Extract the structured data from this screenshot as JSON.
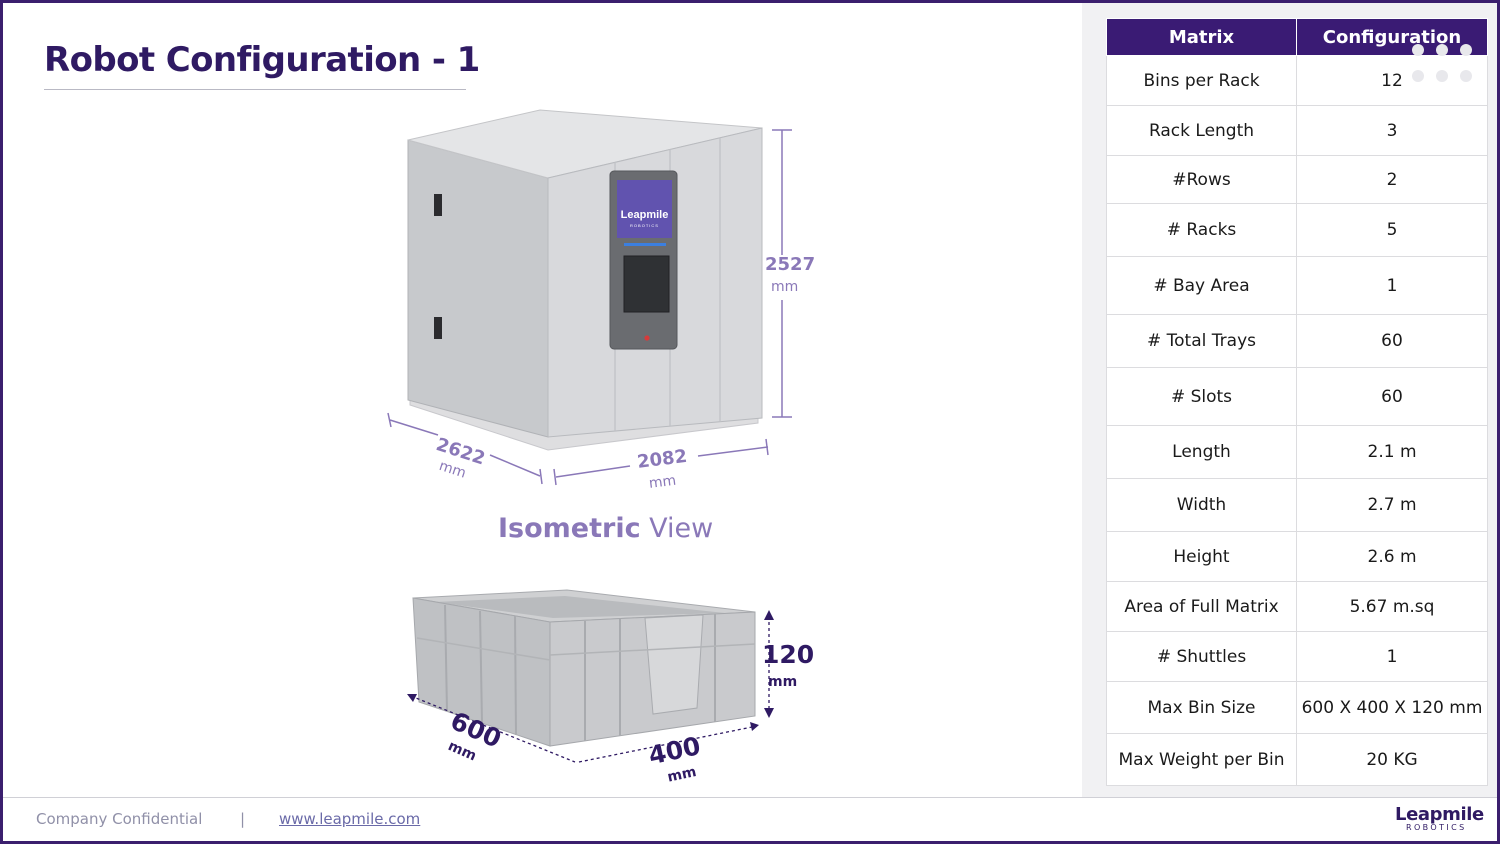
{
  "title": "Robot Configuration - 1",
  "table": {
    "header": [
      "Matrix",
      "Configuration"
    ],
    "rows": [
      [
        "Bins per Rack",
        "12"
      ],
      [
        "Rack Length",
        "3"
      ],
      [
        "#Rows",
        "2"
      ],
      [
        "# Racks",
        "5"
      ],
      [
        "# Bay Area",
        "1"
      ],
      [
        "# Total Trays",
        "60"
      ],
      [
        "# Slots",
        "60"
      ],
      [
        "Length",
        "2.1 m"
      ],
      [
        "Width",
        "2.7 m"
      ],
      [
        "Height",
        "2.6 m"
      ],
      [
        "Area of Full Matrix",
        "5.67 m.sq"
      ],
      [
        "# Shuttles",
        "1"
      ],
      [
        "Max Bin Size",
        "600 X 400 X 120 mm"
      ],
      [
        "Max Weight per Bin",
        "20 KG"
      ]
    ]
  },
  "machine": {
    "screen_logo": "Leapmile",
    "screen_logo_sub": "ROBOTICS",
    "height_value": "2527",
    "height_unit": "mm",
    "depth_value": "2622",
    "depth_unit": "mm",
    "width_value": "2082",
    "width_unit": "mm"
  },
  "caption": {
    "bold": "Isometric",
    "rest": " View"
  },
  "bin": {
    "height_value": "120",
    "height_unit": "mm",
    "length_value": "600",
    "length_unit": "mm",
    "width_value": "400",
    "width_unit": "mm"
  },
  "footer": {
    "confidential": "Company Confidential",
    "separator": "|",
    "website": "www.leapmile.com",
    "logo": "Leapmile",
    "logo_sub": "ROBOTICS"
  },
  "colors": {
    "brand_dark": "#2f1a63",
    "table_header": "#3a1b74",
    "accent_light": "#8a78b8"
  }
}
